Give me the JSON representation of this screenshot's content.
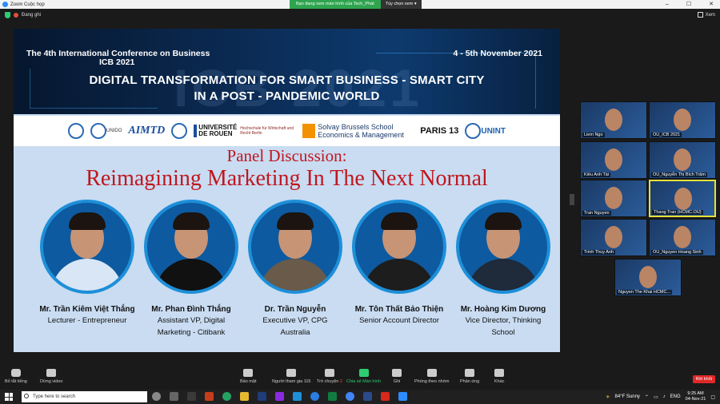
{
  "window": {
    "title": "Zoom Cuộc họp",
    "share_banner": "Bạn đang xem màn hình của Tech_Phát",
    "share_option": "Tùy chọn xem",
    "recording": "Đang ghi",
    "view_label": "Xem"
  },
  "slide": {
    "conf_line1": "The 4th International Conference on Business",
    "conf_line2": "ICB 2021",
    "date": "4 - 5th November 2021",
    "headline_1": "DIGITAL TRANSFORMATION FOR SMART BUSINESS - SMART CITY",
    "headline_2": "IN A POST - PANDEMIC WORLD",
    "watermark": "ICB 2021",
    "logos": {
      "aimtd": "AIMTD",
      "rouen": "UNIVERSITÉ DE ROUEN",
      "hwr": "Hochschule für Wirtschaft und Recht Berlin",
      "solvay": "Solvay Brussels School Economics & Management",
      "paris": "PARIS 13",
      "unint": "UNINT",
      "unido": "UNIDO"
    },
    "panel_label": "Panel Discussion:",
    "panel_title": "Reimagining Marketing In The Next Normal",
    "speakers": [
      {
        "name": "Mr. Trần Kiêm Việt Thắng",
        "role": "Lecturer - Entrepreneur",
        "role2": "",
        "shirt": "#d8e6f5"
      },
      {
        "name": "Mr. Phan Đình Thắng",
        "role": "Assistant VP, Digital",
        "role2": "Marketing - Citibank",
        "shirt": "#111111"
      },
      {
        "name": "Dr. Trần Nguyễn",
        "role": "Executive VP, CPG",
        "role2": "Australia",
        "shirt": "#6a5a4a"
      },
      {
        "name": "Mr. Tôn Thất Bảo Thiện",
        "role": "Senior Account Director",
        "role2": "",
        "shirt": "#1d1d1d"
      },
      {
        "name": "Mr. Hoàng Kim Dương",
        "role": "Vice Director, Thinking",
        "role2": "School",
        "shirt": "#1f2a3a"
      }
    ]
  },
  "participants": [
    "Liem Ngo",
    "OU_ICB 2021",
    "Kiều Anh Tài",
    "OU_Nguyễn Thị Bích Trâm",
    "Tran Nguyen",
    "Thang Tran (HCMC.OU)",
    "Trinh Thuy Anh",
    "OU_Nguyen Hoang Sinh",
    "Nguyen The Khai HCMC..."
  ],
  "toolbar": {
    "mute": "Bỏ tắt tiếng",
    "video": "Dừng video",
    "security": "Bảo mật",
    "participants": "Người tham gia",
    "participants_count": "115",
    "chat": "Trò chuyện",
    "chat_badge": "2",
    "share": "Chia sẻ Màn hình",
    "record": "Ghi",
    "breakout": "Phòng theo nhóm",
    "reactions": "Phản ứng",
    "more": "Khác",
    "leave": "Rời khỏi"
  },
  "taskbar": {
    "search": "Type here to search",
    "weather": "84°F Sunny",
    "lang": "ENG",
    "time": "9:25 AM",
    "date": "04-Nov-21"
  }
}
